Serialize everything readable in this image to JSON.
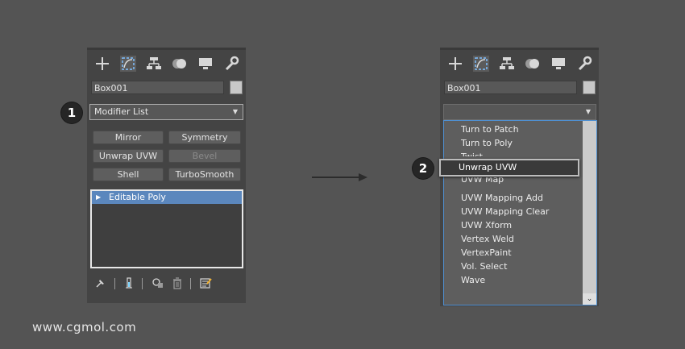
{
  "left_panel": {
    "object_name": "Box001",
    "modifier_list_label": "Modifier List",
    "buttons": [
      {
        "label": "Mirror",
        "enabled": true
      },
      {
        "label": "Symmetry",
        "enabled": true
      },
      {
        "label": "Unwrap UVW",
        "enabled": true
      },
      {
        "label": "Bevel",
        "enabled": false
      },
      {
        "label": "Shell",
        "enabled": true
      },
      {
        "label": "TurboSmooth",
        "enabled": true
      }
    ],
    "stack_item": "Editable Poly",
    "callout": "1"
  },
  "right_panel": {
    "object_name": "Box001",
    "modifier_list_label": "",
    "callout": "2",
    "dropdown_items": [
      "Turn to Patch",
      "Turn to Poly",
      "Twist",
      "UVW Map",
      "UVW Mapping Add",
      "UVW Mapping Clear",
      "UVW Xform",
      "Vertex Weld",
      "VertexPaint",
      "Vol. Select",
      "Wave"
    ],
    "highlighted_item": "Unwrap UVW"
  },
  "toolbar_icons": [
    "create-icon",
    "modify-icon",
    "hierarchy-icon",
    "motion-icon",
    "display-icon",
    "utilities-icon"
  ],
  "bottom_icons": [
    "pin-stack-icon",
    "show-end-result-icon",
    "make-unique-icon",
    "remove-modifier-icon",
    "configure-modifier-sets-icon"
  ],
  "watermark": "www.cgmol.com",
  "colors": {
    "background": "#545454",
    "panel": "#444444",
    "selection_blue": "#5b87bd",
    "dropdown_border": "#4f8fd0"
  }
}
